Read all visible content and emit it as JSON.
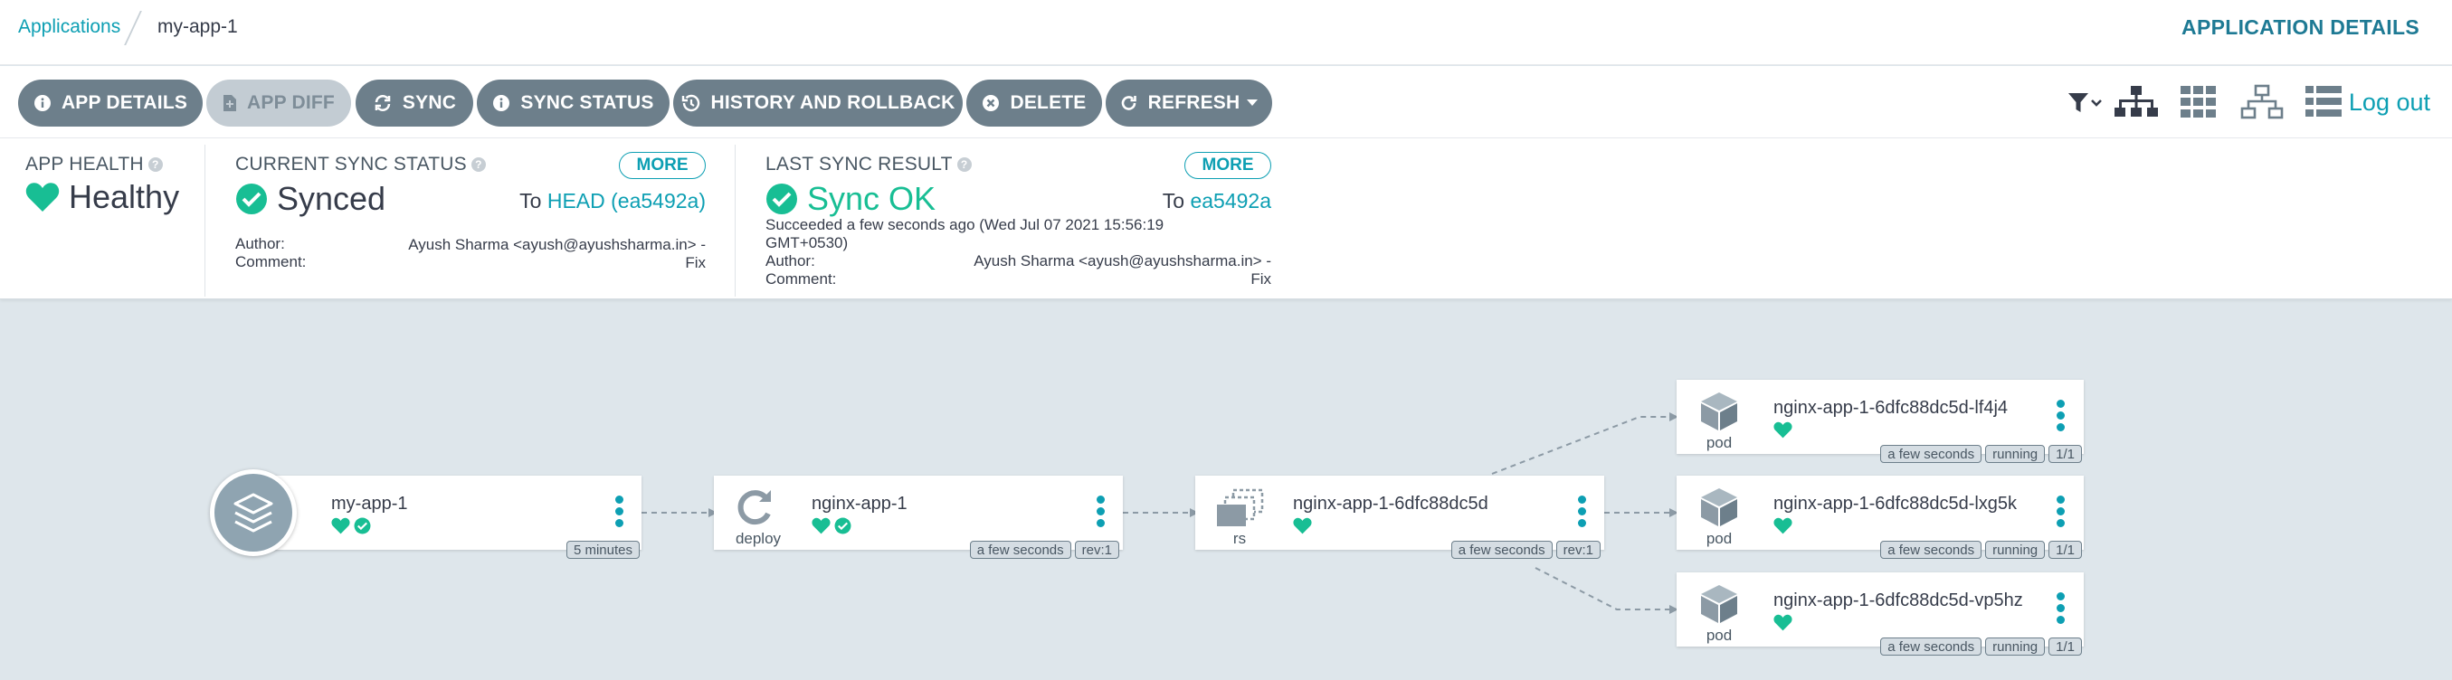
{
  "breadcrumb": {
    "root": "Applications",
    "current": "my-app-1"
  },
  "header": {
    "title": "APPLICATION DETAILS"
  },
  "toolbar": {
    "buttons": [
      {
        "label": "APP DETAILS",
        "icon": "info-icon"
      },
      {
        "label": "APP DIFF",
        "icon": "file-diff-icon",
        "disabled": true
      },
      {
        "label": "SYNC",
        "icon": "sync-icon"
      },
      {
        "label": "SYNC STATUS",
        "icon": "info-icon"
      },
      {
        "label": "HISTORY AND ROLLBACK",
        "icon": "history-icon"
      },
      {
        "label": "DELETE",
        "icon": "delete-circle-icon"
      },
      {
        "label": "REFRESH",
        "icon": "refresh-icon"
      }
    ],
    "logout": "Log out"
  },
  "health": {
    "title": "APP HEALTH",
    "status": "Healthy",
    "color": "#18be94"
  },
  "current_sync": {
    "title": "CURRENT SYNC STATUS",
    "more": "MORE",
    "status": "Synced",
    "to_prefix": "To",
    "revision": "HEAD (ea5492a)",
    "author_label": "Author:",
    "comment_label": "Comment:",
    "author": "Ayush Sharma <ayush@ayushsharma.in> -",
    "comment": "Fix"
  },
  "last_sync": {
    "title": "LAST SYNC RESULT",
    "more": "MORE",
    "status": "Sync OK",
    "to_prefix": "To",
    "revision": "ea5492a",
    "succeeded_line1": "Succeeded a few seconds ago (Wed Jul 07 2021 15:56:19",
    "succeeded_line2": "GMT+0530)",
    "author_label": "Author:",
    "comment_label": "Comment:",
    "author": "Ayush Sharma <ayush@ayushsharma.in> -",
    "comment": "Fix"
  },
  "graph": {
    "app": {
      "name": "my-app-1",
      "tags": [
        "5 minutes"
      ]
    },
    "deploy": {
      "name": "nginx-app-1",
      "kind": "deploy",
      "tags": [
        "a few seconds",
        "rev:1"
      ]
    },
    "rs": {
      "name": "nginx-app-1-6dfc88dc5d",
      "kind": "rs",
      "tags": [
        "a few seconds",
        "rev:1"
      ]
    },
    "pods": [
      {
        "name": "nginx-app-1-6dfc88dc5d-lf4j4",
        "kind": "pod",
        "tags": [
          "a few seconds",
          "running",
          "1/1"
        ]
      },
      {
        "name": "nginx-app-1-6dfc88dc5d-lxg5k",
        "kind": "pod",
        "tags": [
          "a few seconds",
          "running",
          "1/1"
        ]
      },
      {
        "name": "nginx-app-1-6dfc88dc5d-vp5hz",
        "kind": "pod",
        "tags": [
          "a few seconds",
          "running",
          "1/1"
        ]
      }
    ]
  },
  "colors": {
    "accent": "#0d9fb3",
    "healthy": "#18be94",
    "button": "#6d7f8b"
  }
}
